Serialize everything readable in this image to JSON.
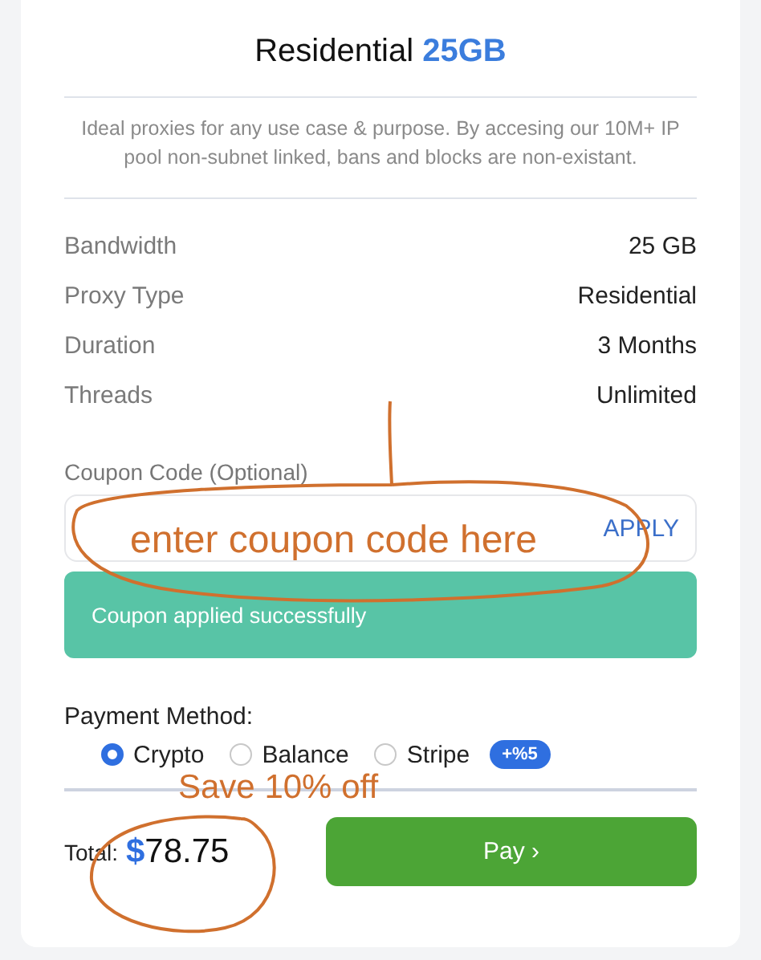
{
  "title": {
    "text": "Residential",
    "highlight": "25GB"
  },
  "description": "Ideal proxies for any use case & purpose. By accesing our 10M+ IP pool non-subnet linked, bans and blocks are non-existant.",
  "details": [
    {
      "label": "Bandwidth",
      "value": "25 GB"
    },
    {
      "label": "Proxy Type",
      "value": "Residential"
    },
    {
      "label": "Duration",
      "value": "3 Months"
    },
    {
      "label": "Threads",
      "value": "Unlimited"
    }
  ],
  "coupon": {
    "label": "Coupon Code (Optional)",
    "button": "APPLY",
    "message": "Coupon applied successfully"
  },
  "payment": {
    "label": "Payment Method:",
    "options": [
      {
        "label": "Crypto",
        "selected": true
      },
      {
        "label": "Balance",
        "selected": false
      },
      {
        "label": "Stripe",
        "selected": false,
        "badge": "+%5"
      }
    ]
  },
  "total": {
    "label": "Total:",
    "currency": "$",
    "amount": "78.75"
  },
  "pay_button": "Pay ›",
  "annotations": [
    {
      "kind": "coupon",
      "text": "enter coupon code here"
    },
    {
      "kind": "saving",
      "text": "Save 10% off"
    }
  ]
}
